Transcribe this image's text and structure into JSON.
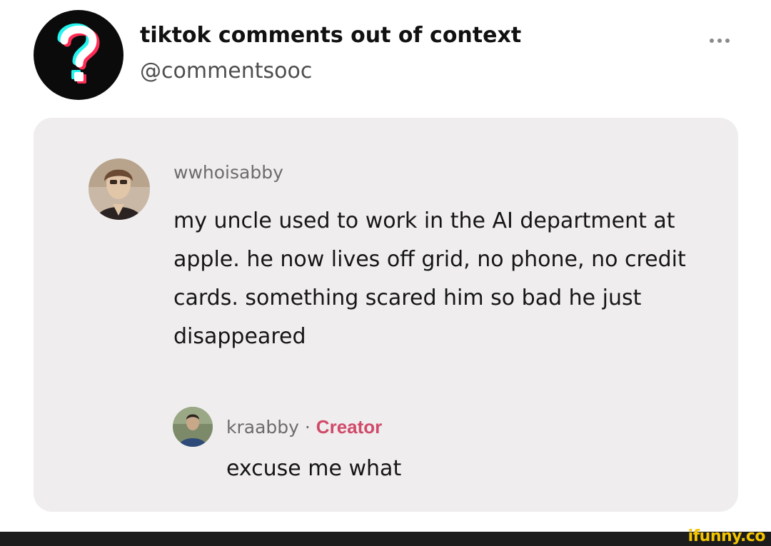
{
  "account": {
    "name": "tiktok comments out of context",
    "handle": "@commentsooc",
    "avatar_icon": "question-mark-icon"
  },
  "header": {
    "more_icon": "more-dots-icon"
  },
  "comment": {
    "username": "wwhoisabby",
    "text": "my uncle used to work in the AI department at apple. he now lives off grid, no phone, no credit cards. something scared him so bad he just disappeared"
  },
  "reply": {
    "username": "kraabby",
    "separator": "·",
    "badge": "Creator",
    "text": "excuse me what"
  },
  "watermark": {
    "text": "ifunny.co"
  },
  "colors": {
    "card_background": "#efedee",
    "creator_badge": "#d04a6a",
    "watermark": "#f4c600",
    "footer_bar": "#1c1c1c"
  }
}
